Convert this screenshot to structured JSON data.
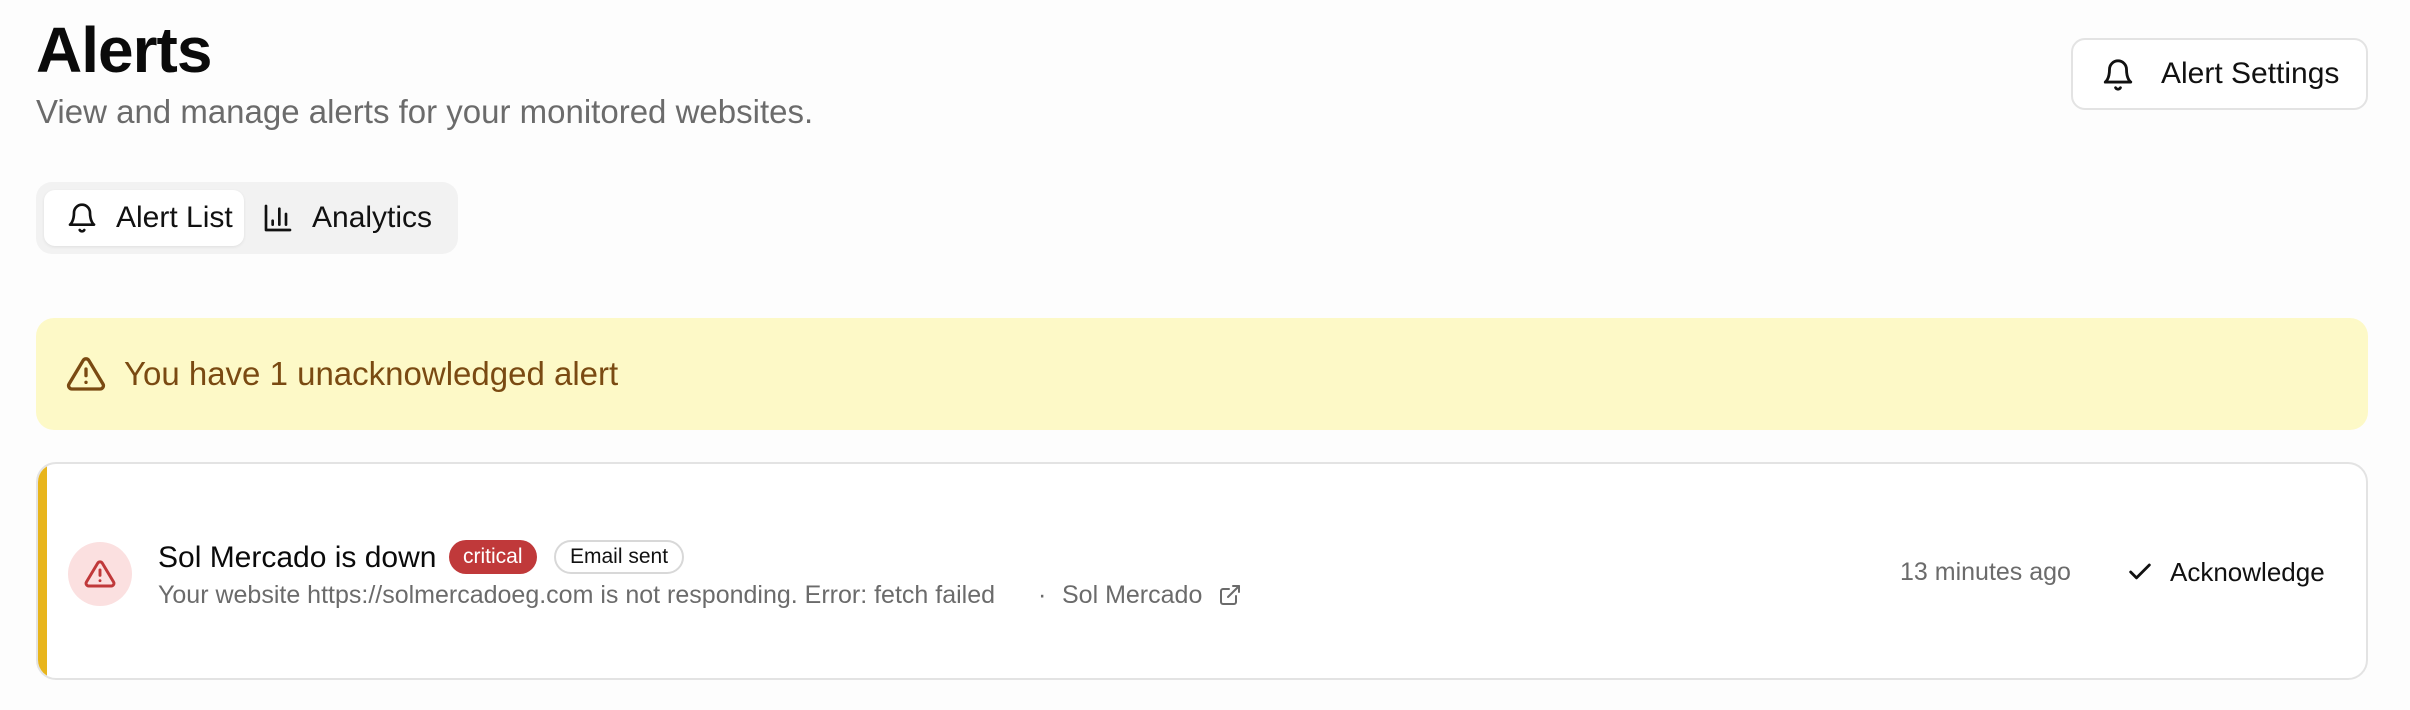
{
  "header": {
    "title": "Alerts",
    "subtitle": "View and manage alerts for your monitored websites.",
    "settings_button": {
      "label": "Alert Settings",
      "icon": "bell-icon"
    }
  },
  "tabs": [
    {
      "label": "Alert List",
      "icon": "bell-icon",
      "active": true
    },
    {
      "label": "Analytics",
      "icon": "bar-chart-icon",
      "active": false
    }
  ],
  "banner": {
    "text": "You have 1 unacknowledged alert",
    "icon": "warning-icon",
    "colors": {
      "background": "#fdf9c7",
      "text": "#7a4a12"
    }
  },
  "alerts": [
    {
      "title": "Sol Mercado is down",
      "severity": "critical",
      "notification": "Email sent",
      "description": "Your website https://solmercadoeg.com is not responding. Error: fetch failed",
      "separator": "·",
      "site": "Sol Mercado",
      "time": "13 minutes ago",
      "action_label": "Acknowledge",
      "colors": {
        "accent": "#e8b51c",
        "severity": "#c0393a",
        "icon_bg": "#fbe0e0"
      }
    }
  ]
}
